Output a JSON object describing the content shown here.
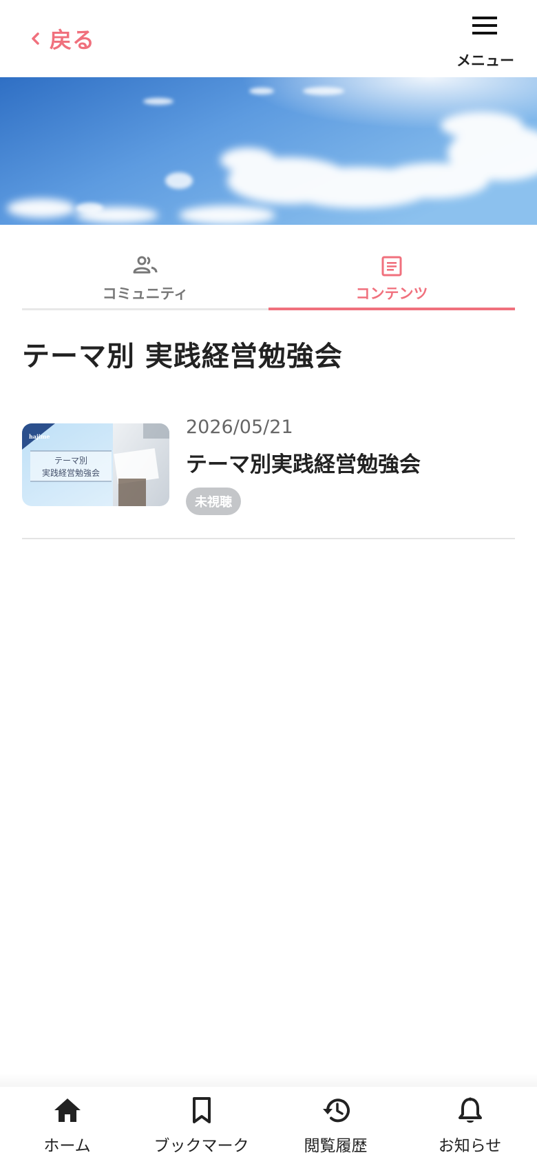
{
  "header": {
    "back_label": "戻る",
    "menu_label": "メニュー"
  },
  "tabs": [
    {
      "label": "コミュニティ",
      "icon": "people-icon",
      "active": false
    },
    {
      "label": "コンテンツ",
      "icon": "article-icon",
      "active": true
    }
  ],
  "section": {
    "title": "テーマ別 実践経営勉強会"
  },
  "items": [
    {
      "date": "2026/05/21",
      "title": "テーマ別実践経営勉強会",
      "badge": "未視聴",
      "thumbnail": {
        "logo_text": "hajime",
        "line1": "テーマ別",
        "line2": "実践経営勉強会"
      }
    }
  ],
  "bottom_nav": [
    {
      "label": "ホーム",
      "icon": "home-icon"
    },
    {
      "label": "ブックマーク",
      "icon": "bookmark-icon"
    },
    {
      "label": "閲覧履歴",
      "icon": "history-icon"
    },
    {
      "label": "お知らせ",
      "icon": "bell-icon"
    }
  ],
  "colors": {
    "accent": "#f0707d",
    "badge_bg": "#c4c6c9",
    "text": "#222222"
  }
}
